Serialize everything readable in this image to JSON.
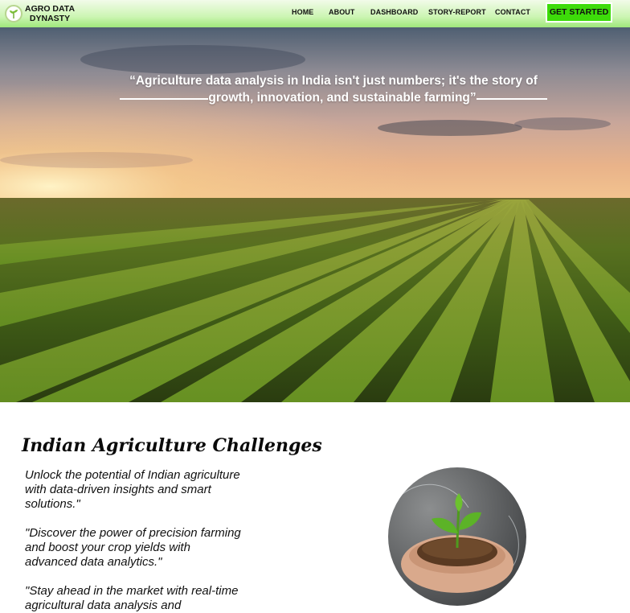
{
  "nav": {
    "brand_line1": "AGRO DATA",
    "brand_line2": "DYNASTY",
    "links": [
      "HOME",
      "ABOUT",
      "DASHBOARD",
      "STORY-REPORT",
      "CONTACT"
    ],
    "cta": "GET STARTED"
  },
  "hero": {
    "quote_line1": "“Agriculture data analysis in India isn't just numbers; it's the story of",
    "quote_line2": "growth, innovation, and sustainable farming”"
  },
  "content": {
    "title": "Indian Agriculture Challenges",
    "paragraphs": [
      "Unlock the potential of Indian agriculture with data-driven insights and smart solutions.\"",
      "\"Discover the power of precision farming and boost your crop yields with advanced data analytics.\"",
      "\"Stay ahead in the market with real-time agricultural data analysis and"
    ]
  },
  "colors": {
    "nav_bg": "#cdf5b4",
    "cta_bg": "#3ddb0a",
    "text": "#111111"
  },
  "icons": {
    "logo": "leaf-logo-icon"
  }
}
